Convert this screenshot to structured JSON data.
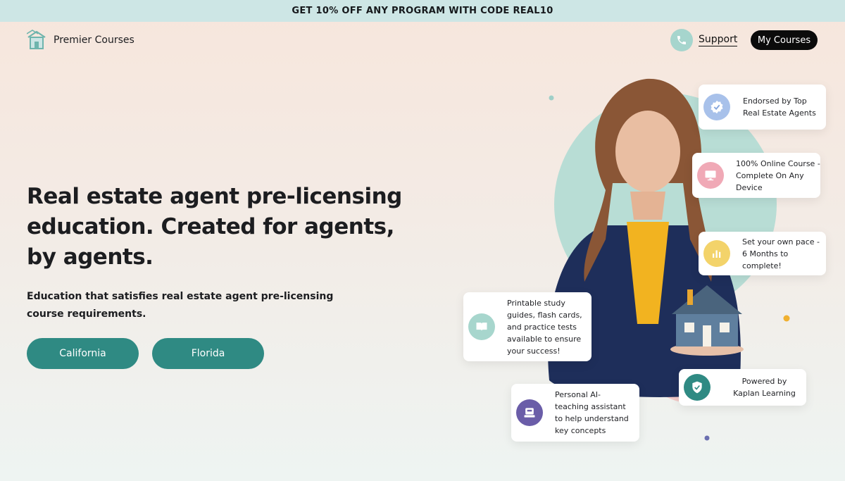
{
  "promo": {
    "text": "GET 10% OFF ANY PROGRAM WITH CODE REAL10"
  },
  "header": {
    "brand": "Premier Courses",
    "support_label": "Support",
    "my_courses_label": "My Courses"
  },
  "hero": {
    "headline": "Real estate agent pre-licensing education. Created for agents, by agents.",
    "subheadline": "Education that satisfies real estate agent pre-licensing course requirements.",
    "buttons": [
      "California",
      "Florida"
    ]
  },
  "features": [
    {
      "icon": "verified-badge-icon",
      "text": "Endorsed by Top Real Estate Agents"
    },
    {
      "icon": "monitor-icon",
      "text": "100% Online Course - Complete On Any Device"
    },
    {
      "icon": "bar-chart-icon",
      "text": "Set your own pace - 6 Months to complete!"
    },
    {
      "icon": "book-icon",
      "text": "Printable study guides, flash cards, and practice tests available to ensure your success!"
    },
    {
      "icon": "shield-check-icon",
      "text": "Powered by Kaplan Learning"
    },
    {
      "icon": "ai-assistant-icon",
      "text": "Personal AI-teaching assistant to help understand key concepts"
    }
  ],
  "colors": {
    "promo_bar": "#cde6e5",
    "accent_teal": "#2f8a83",
    "support_circle": "#a6d5cd",
    "my_courses_bg": "#0b0b0b"
  }
}
